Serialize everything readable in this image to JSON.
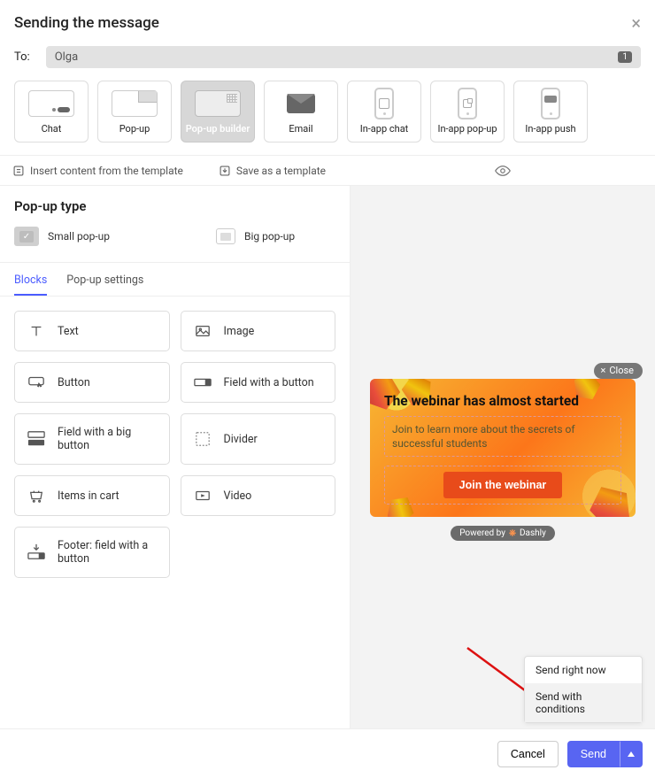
{
  "header": {
    "title": "Sending the message"
  },
  "to": {
    "label": "To:",
    "recipient": "Olga",
    "count": "1"
  },
  "channels": [
    {
      "key": "chat",
      "label": "Chat"
    },
    {
      "key": "popup",
      "label": "Pop-up"
    },
    {
      "key": "builder",
      "label": "Pop-up builder"
    },
    {
      "key": "email",
      "label": "Email"
    },
    {
      "key": "inappchat",
      "label": "In-app chat"
    },
    {
      "key": "inapppopup",
      "label": "In-app pop-up"
    },
    {
      "key": "inapppush",
      "label": "In-app push"
    }
  ],
  "toolbar": {
    "insert_template": "Insert content from the template",
    "save_template": "Save as a template"
  },
  "popup_type": {
    "title": "Pop-up type",
    "small": "Small pop-up",
    "big": "Big pop-up"
  },
  "tabs": {
    "blocks": "Blocks",
    "settings": "Pop-up settings"
  },
  "blocks": {
    "text": "Text",
    "image": "Image",
    "button": "Button",
    "field_button": "Field with a button",
    "field_big_button": "Field with a big button",
    "divider": "Divider",
    "items_cart": "Items in cart",
    "video": "Video",
    "footer_field": "Footer: field with a button"
  },
  "preview": {
    "close": "Close",
    "title": "The webinar has almost started",
    "body": "Join to learn more about the secrets of successful students",
    "cta": "Join the webinar",
    "powered_prefix": "Powered by",
    "powered_name": "Dashly"
  },
  "send_menu": {
    "now": "Send right now",
    "cond": "Send with conditions"
  },
  "footer": {
    "cancel": "Cancel",
    "send": "Send"
  }
}
